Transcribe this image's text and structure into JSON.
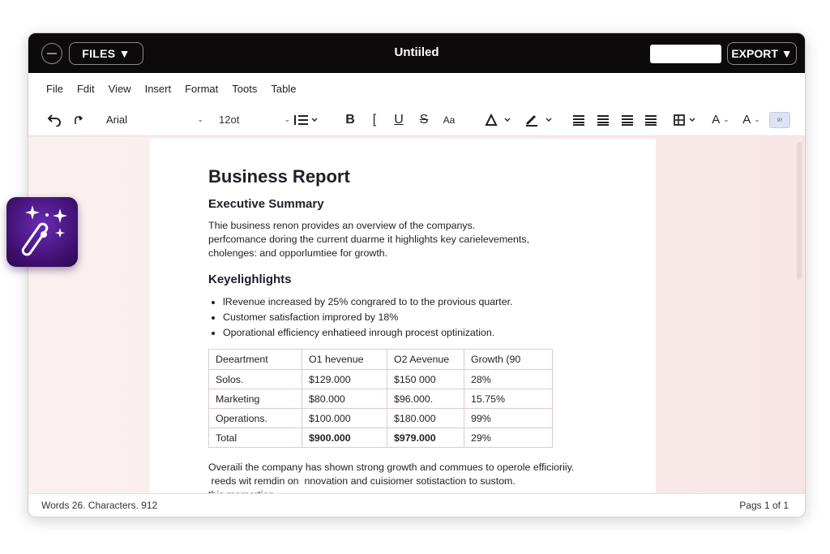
{
  "window": {
    "title": "Untiiled",
    "files_label": "FILES ▼",
    "export_label": "EXPORT ▼"
  },
  "menu": [
    "File",
    "Fdit",
    "View",
    "Insert",
    "Format",
    "Toots",
    "Table"
  ],
  "toolbar": {
    "font": "Arial",
    "size": "12ot",
    "icons": [
      "undo-icon",
      "redo-icon",
      "line-spacing-icon",
      "bold-icon",
      "italic-icon",
      "underline-icon",
      "strikethrough-icon",
      "font-case-icon",
      "text-color-icon",
      "highlight-icon",
      "align-left-icon",
      "align-center-icon",
      "align-right-icon",
      "justify-icon",
      "table-icon",
      "font-size-up-icon",
      "font-size-down-icon",
      "more-icon"
    ],
    "case_label": "Aa",
    "a_label": "A"
  },
  "document": {
    "title": "Business Report",
    "sections": {
      "summary_heading": "Executive Summary",
      "summary_lines": [
        "Thie business renon provides an overview of the companys.",
        "perfcomance doring the current duarme it highlights key carielevements,",
        "cholenges: and opporlumtiee for growth."
      ],
      "highlights_heading": "Keyelighlights",
      "highlights": [
        "lRevenue increased by 25% congrared to to the provious quarter.",
        "Customer satisfaction improred by 18%",
        "Oporational efficiency enhatieed inrough procest optinization."
      ]
    },
    "table": {
      "headers": [
        "Deeartment",
        "O1 hevenue",
        "O2 Aevenue",
        "Growth (90"
      ],
      "rows": [
        [
          "Solos.",
          "$129.000",
          "$150 000",
          "28%"
        ],
        [
          "Marketing",
          "$80.000",
          "$96.000.",
          "15.75%"
        ],
        [
          "Operations.",
          "$100.000",
          "$180.000",
          "99%"
        ],
        [
          "Total",
          "$900.000",
          "$979.000",
          "29%"
        ]
      ]
    },
    "closing_lines": [
      "Overaili the company has shown strong growth and commues to operole efficioriiy.",
      " reeds wit remdin on  nnovation and cuisiomer sotistaction to sustom.",
      "this momertion."
    ]
  },
  "status": {
    "left": "Words 26. Characters. 912",
    "right": "Pags 1 of 1"
  },
  "colors": {
    "titlebar": "#0d0a0b",
    "canvas": "#f8e6e6",
    "accent_tile": "#4b1685"
  }
}
